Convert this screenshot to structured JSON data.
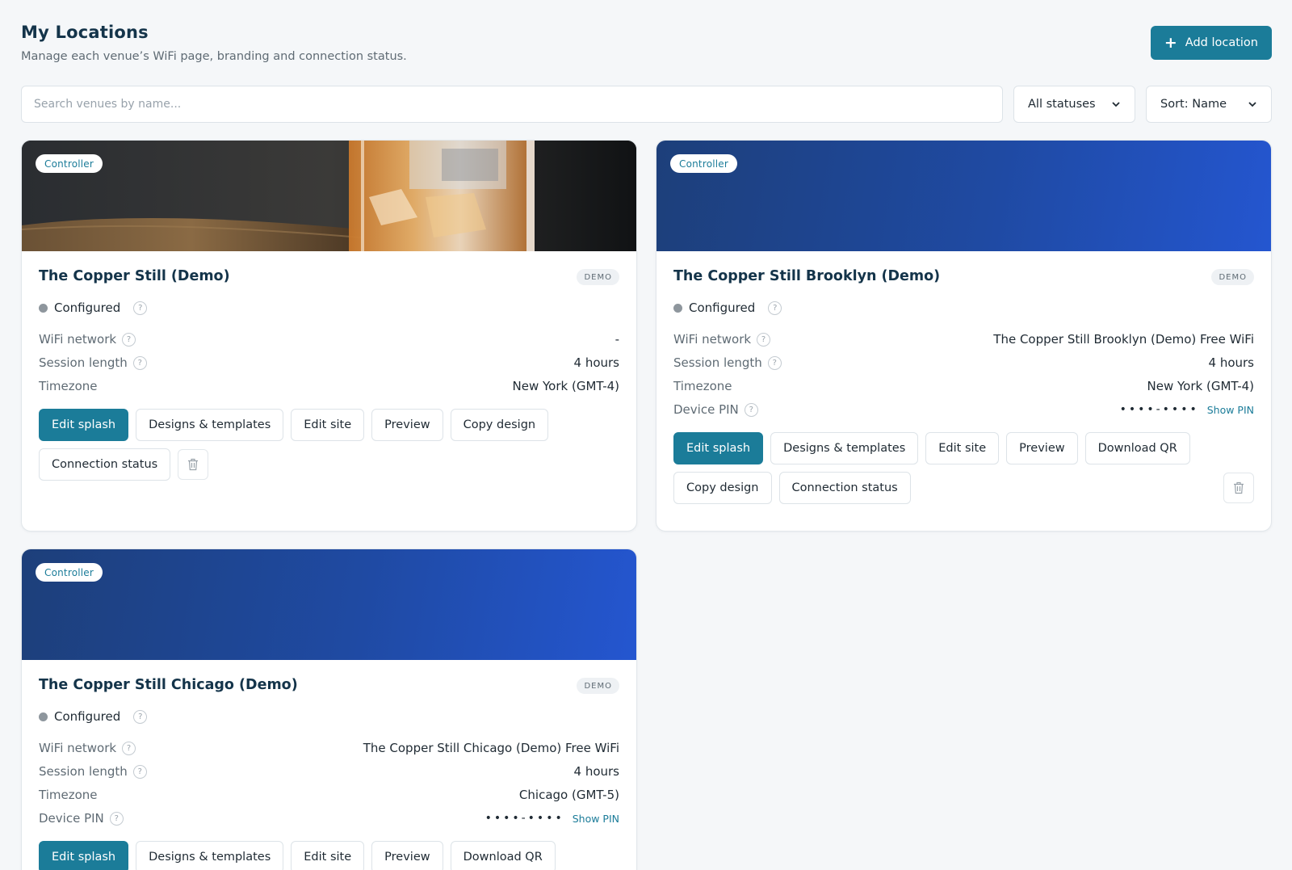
{
  "header": {
    "title": "My Locations",
    "subtitle": "Manage each venue’s WiFi page, branding and connection status.",
    "add_button": "Add location"
  },
  "toolbar": {
    "search_placeholder": "Search venues by name...",
    "status_filter": "All statuses",
    "sort": "Sort: Name"
  },
  "labels": {
    "wifi_network": "WiFi network",
    "session_length": "Session length",
    "timezone": "Timezone",
    "device_pin": "Device PIN",
    "show_pin": "Show PIN",
    "help": "?",
    "pin_mask": "••••-••••"
  },
  "buttons": {
    "edit_splash": "Edit splash",
    "designs_templates": "Designs & templates",
    "edit_site": "Edit site",
    "preview": "Preview",
    "copy_design": "Copy design",
    "connection_status": "Connection status",
    "download_qr": "Download QR"
  },
  "colors": {
    "accent": "#1b7c99",
    "banner_gradient_start": "#1d3f7a",
    "banner_gradient_end": "#2456d0",
    "status_dot": "#8e969d"
  },
  "venues": [
    {
      "name": "The Copper Still (Demo)",
      "badge": "Controller",
      "tag": "DEMO",
      "status": "Configured",
      "wifi_network": "-",
      "session_length": "4 hours",
      "timezone": "New York (GMT-4)"
    },
    {
      "name": "The Copper Still Brooklyn (Demo)",
      "badge": "Controller",
      "tag": "DEMO",
      "status": "Configured",
      "wifi_network": "The Copper Still Brooklyn (Demo) Free WiFi",
      "session_length": "4 hours",
      "timezone": "New York (GMT-4)"
    },
    {
      "name": "The Copper Still Chicago (Demo)",
      "badge": "Controller",
      "tag": "DEMO",
      "status": "Configured",
      "wifi_network": "The Copper Still Chicago (Demo) Free WiFi",
      "session_length": "4 hours",
      "timezone": "Chicago (GMT-5)"
    }
  ]
}
